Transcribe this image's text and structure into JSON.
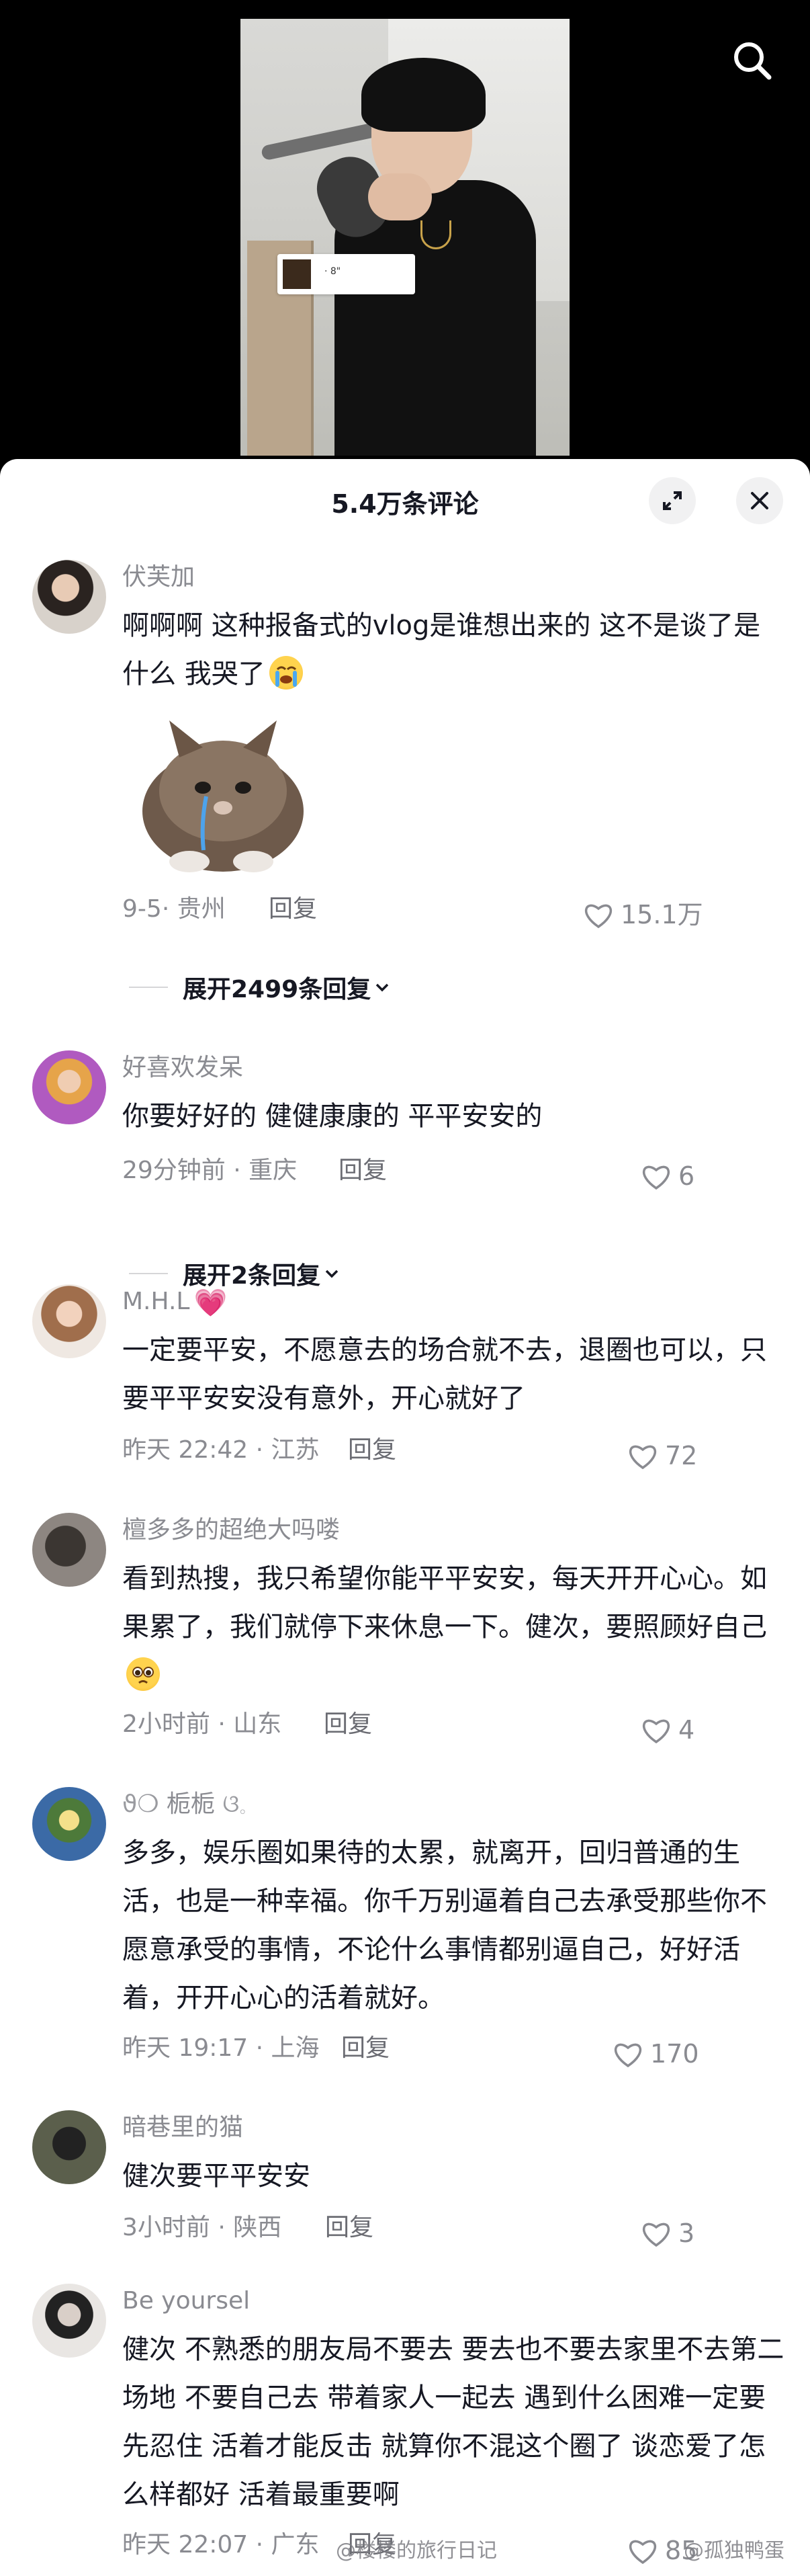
{
  "video": {
    "overlay_text": "· 8\""
  },
  "sheet": {
    "title": "5.4万条评论"
  },
  "comments": [
    {
      "name": "伏芙加",
      "text": "啊啊啊 这种报备式的vlog是谁想出来的 这不是谈了是什么 我哭了",
      "emoji": "loudly-crying-face",
      "sticker": "crying-kitten",
      "time": "9-5",
      "location": "贵州",
      "reply_label": "回复",
      "likes": "15.1万",
      "expand_label": "展开2499条回复"
    },
    {
      "name": "好喜欢发呆",
      "text": "你要好好的 健健康康的 平平安安的",
      "time": "29分钟前",
      "location": "重庆",
      "reply_label": "回复",
      "likes": "6",
      "expand_label": "展开2条回复"
    },
    {
      "name": "M.H.L",
      "name_emoji": "💗",
      "text": "一定要平安，不愿意去的场合就不去，退圈也可以，只要平平安安没有意外，开心就好了",
      "time": "昨天 22:42",
      "location": "江苏",
      "reply_label": "回复",
      "likes": "72"
    },
    {
      "name": "檀多多的超绝大吗喽",
      "text": "看到热搜，我只希望你能平平安安，每天开开心心。如果累了，我们就停下来休息一下。健次，要照顾好自己",
      "emoji": "pleading-face",
      "time": "2小时前",
      "location": "山东",
      "reply_label": "回复",
      "likes": "4"
    },
    {
      "name": "栀栀",
      "name_prefix": "ϑ❍",
      "name_suffix": "ଓ𓈒",
      "text": "多多，娱乐圈如果待的太累，就离开，回归普通的生活，也是一种幸福。你千万别逼着自己去承受那些你不愿意承受的事情，不论什么事情都别逼自己，好好活着，开开心心的活着就好。",
      "time": "昨天 19:17",
      "location": "上海",
      "reply_label": "回复",
      "likes": "170"
    },
    {
      "name": "暗巷里的猫",
      "text": "健次要平平安安",
      "time": "3小时前",
      "location": "陕西",
      "reply_label": "回复",
      "likes": "3"
    },
    {
      "name": "Be yoursel",
      "text": "健次 不熟悉的朋友局不要去 要去也不要去家里不去第二场地 不要自己去 带着家人一起去 遇到什么困难一定要先忍住 活着才能反击 就算你不混这个圈了 谈恋爱了怎么样都好 活着最重要啊",
      "time": "昨天 22:07",
      "location": "广东",
      "reply_label": "回复",
      "likes": "85"
    }
  ],
  "watermarks": [
    "@楼楼的旅行日记",
    "@孤独鸭蛋"
  ]
}
